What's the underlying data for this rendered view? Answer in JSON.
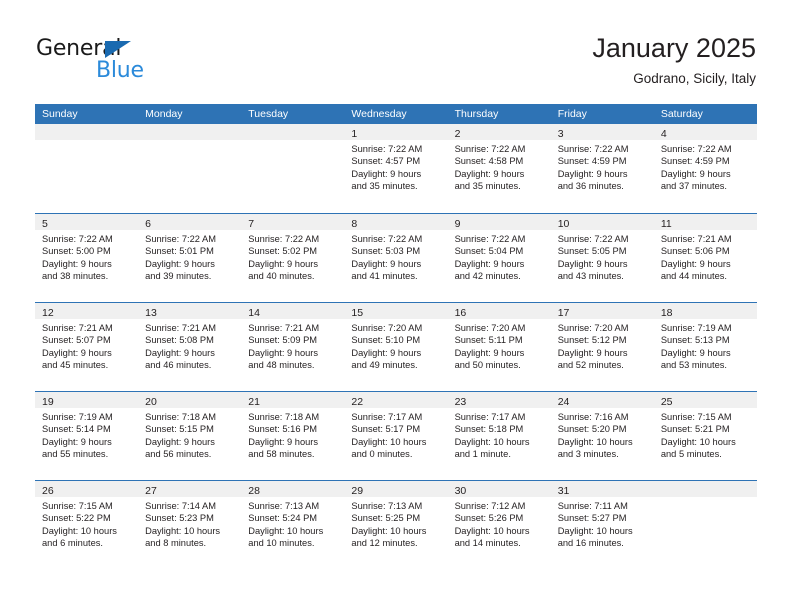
{
  "logo": {
    "word_one": "General",
    "word_two": "Blue",
    "triangle_color": "#1a6ab0",
    "blue_text_color": "#2b8ada"
  },
  "header": {
    "month_title": "January 2025",
    "location": "Godrano, Sicily, Italy"
  },
  "theme": {
    "header_blue": "#2e73b5",
    "daynum_band_gray": "#f0f0f0",
    "text_color": "#231f20"
  },
  "calendar": {
    "day_names": [
      "Sunday",
      "Monday",
      "Tuesday",
      "Wednesday",
      "Thursday",
      "Friday",
      "Saturday"
    ],
    "weeks": [
      [
        {
          "day": "",
          "sunrise": "",
          "sunset": "",
          "daylight_line1": "",
          "daylight_line2": "",
          "empty": true
        },
        {
          "day": "",
          "sunrise": "",
          "sunset": "",
          "daylight_line1": "",
          "daylight_line2": "",
          "empty": true
        },
        {
          "day": "",
          "sunrise": "",
          "sunset": "",
          "daylight_line1": "",
          "daylight_line2": "",
          "empty": true
        },
        {
          "day": "1",
          "sunrise": "Sunrise: 7:22 AM",
          "sunset": "Sunset: 4:57 PM",
          "daylight_line1": "Daylight: 9 hours",
          "daylight_line2": "and 35 minutes.",
          "empty": false
        },
        {
          "day": "2",
          "sunrise": "Sunrise: 7:22 AM",
          "sunset": "Sunset: 4:58 PM",
          "daylight_line1": "Daylight: 9 hours",
          "daylight_line2": "and 35 minutes.",
          "empty": false
        },
        {
          "day": "3",
          "sunrise": "Sunrise: 7:22 AM",
          "sunset": "Sunset: 4:59 PM",
          "daylight_line1": "Daylight: 9 hours",
          "daylight_line2": "and 36 minutes.",
          "empty": false
        },
        {
          "day": "4",
          "sunrise": "Sunrise: 7:22 AM",
          "sunset": "Sunset: 4:59 PM",
          "daylight_line1": "Daylight: 9 hours",
          "daylight_line2": "and 37 minutes.",
          "empty": false
        }
      ],
      [
        {
          "day": "5",
          "sunrise": "Sunrise: 7:22 AM",
          "sunset": "Sunset: 5:00 PM",
          "daylight_line1": "Daylight: 9 hours",
          "daylight_line2": "and 38 minutes.",
          "empty": false
        },
        {
          "day": "6",
          "sunrise": "Sunrise: 7:22 AM",
          "sunset": "Sunset: 5:01 PM",
          "daylight_line1": "Daylight: 9 hours",
          "daylight_line2": "and 39 minutes.",
          "empty": false
        },
        {
          "day": "7",
          "sunrise": "Sunrise: 7:22 AM",
          "sunset": "Sunset: 5:02 PM",
          "daylight_line1": "Daylight: 9 hours",
          "daylight_line2": "and 40 minutes.",
          "empty": false
        },
        {
          "day": "8",
          "sunrise": "Sunrise: 7:22 AM",
          "sunset": "Sunset: 5:03 PM",
          "daylight_line1": "Daylight: 9 hours",
          "daylight_line2": "and 41 minutes.",
          "empty": false
        },
        {
          "day": "9",
          "sunrise": "Sunrise: 7:22 AM",
          "sunset": "Sunset: 5:04 PM",
          "daylight_line1": "Daylight: 9 hours",
          "daylight_line2": "and 42 minutes.",
          "empty": false
        },
        {
          "day": "10",
          "sunrise": "Sunrise: 7:22 AM",
          "sunset": "Sunset: 5:05 PM",
          "daylight_line1": "Daylight: 9 hours",
          "daylight_line2": "and 43 minutes.",
          "empty": false
        },
        {
          "day": "11",
          "sunrise": "Sunrise: 7:21 AM",
          "sunset": "Sunset: 5:06 PM",
          "daylight_line1": "Daylight: 9 hours",
          "daylight_line2": "and 44 minutes.",
          "empty": false
        }
      ],
      [
        {
          "day": "12",
          "sunrise": "Sunrise: 7:21 AM",
          "sunset": "Sunset: 5:07 PM",
          "daylight_line1": "Daylight: 9 hours",
          "daylight_line2": "and 45 minutes.",
          "empty": false
        },
        {
          "day": "13",
          "sunrise": "Sunrise: 7:21 AM",
          "sunset": "Sunset: 5:08 PM",
          "daylight_line1": "Daylight: 9 hours",
          "daylight_line2": "and 46 minutes.",
          "empty": false
        },
        {
          "day": "14",
          "sunrise": "Sunrise: 7:21 AM",
          "sunset": "Sunset: 5:09 PM",
          "daylight_line1": "Daylight: 9 hours",
          "daylight_line2": "and 48 minutes.",
          "empty": false
        },
        {
          "day": "15",
          "sunrise": "Sunrise: 7:20 AM",
          "sunset": "Sunset: 5:10 PM",
          "daylight_line1": "Daylight: 9 hours",
          "daylight_line2": "and 49 minutes.",
          "empty": false
        },
        {
          "day": "16",
          "sunrise": "Sunrise: 7:20 AM",
          "sunset": "Sunset: 5:11 PM",
          "daylight_line1": "Daylight: 9 hours",
          "daylight_line2": "and 50 minutes.",
          "empty": false
        },
        {
          "day": "17",
          "sunrise": "Sunrise: 7:20 AM",
          "sunset": "Sunset: 5:12 PM",
          "daylight_line1": "Daylight: 9 hours",
          "daylight_line2": "and 52 minutes.",
          "empty": false
        },
        {
          "day": "18",
          "sunrise": "Sunrise: 7:19 AM",
          "sunset": "Sunset: 5:13 PM",
          "daylight_line1": "Daylight: 9 hours",
          "daylight_line2": "and 53 minutes.",
          "empty": false
        }
      ],
      [
        {
          "day": "19",
          "sunrise": "Sunrise: 7:19 AM",
          "sunset": "Sunset: 5:14 PM",
          "daylight_line1": "Daylight: 9 hours",
          "daylight_line2": "and 55 minutes.",
          "empty": false
        },
        {
          "day": "20",
          "sunrise": "Sunrise: 7:18 AM",
          "sunset": "Sunset: 5:15 PM",
          "daylight_line1": "Daylight: 9 hours",
          "daylight_line2": "and 56 minutes.",
          "empty": false
        },
        {
          "day": "21",
          "sunrise": "Sunrise: 7:18 AM",
          "sunset": "Sunset: 5:16 PM",
          "daylight_line1": "Daylight: 9 hours",
          "daylight_line2": "and 58 minutes.",
          "empty": false
        },
        {
          "day": "22",
          "sunrise": "Sunrise: 7:17 AM",
          "sunset": "Sunset: 5:17 PM",
          "daylight_line1": "Daylight: 10 hours",
          "daylight_line2": "and 0 minutes.",
          "empty": false
        },
        {
          "day": "23",
          "sunrise": "Sunrise: 7:17 AM",
          "sunset": "Sunset: 5:18 PM",
          "daylight_line1": "Daylight: 10 hours",
          "daylight_line2": "and 1 minute.",
          "empty": false
        },
        {
          "day": "24",
          "sunrise": "Sunrise: 7:16 AM",
          "sunset": "Sunset: 5:20 PM",
          "daylight_line1": "Daylight: 10 hours",
          "daylight_line2": "and 3 minutes.",
          "empty": false
        },
        {
          "day": "25",
          "sunrise": "Sunrise: 7:15 AM",
          "sunset": "Sunset: 5:21 PM",
          "daylight_line1": "Daylight: 10 hours",
          "daylight_line2": "and 5 minutes.",
          "empty": false
        }
      ],
      [
        {
          "day": "26",
          "sunrise": "Sunrise: 7:15 AM",
          "sunset": "Sunset: 5:22 PM",
          "daylight_line1": "Daylight: 10 hours",
          "daylight_line2": "and 6 minutes.",
          "empty": false
        },
        {
          "day": "27",
          "sunrise": "Sunrise: 7:14 AM",
          "sunset": "Sunset: 5:23 PM",
          "daylight_line1": "Daylight: 10 hours",
          "daylight_line2": "and 8 minutes.",
          "empty": false
        },
        {
          "day": "28",
          "sunrise": "Sunrise: 7:13 AM",
          "sunset": "Sunset: 5:24 PM",
          "daylight_line1": "Daylight: 10 hours",
          "daylight_line2": "and 10 minutes.",
          "empty": false
        },
        {
          "day": "29",
          "sunrise": "Sunrise: 7:13 AM",
          "sunset": "Sunset: 5:25 PM",
          "daylight_line1": "Daylight: 10 hours",
          "daylight_line2": "and 12 minutes.",
          "empty": false
        },
        {
          "day": "30",
          "sunrise": "Sunrise: 7:12 AM",
          "sunset": "Sunset: 5:26 PM",
          "daylight_line1": "Daylight: 10 hours",
          "daylight_line2": "and 14 minutes.",
          "empty": false
        },
        {
          "day": "31",
          "sunrise": "Sunrise: 7:11 AM",
          "sunset": "Sunset: 5:27 PM",
          "daylight_line1": "Daylight: 10 hours",
          "daylight_line2": "and 16 minutes.",
          "empty": false
        },
        {
          "day": "",
          "sunrise": "",
          "sunset": "",
          "daylight_line1": "",
          "daylight_line2": "",
          "empty": true
        }
      ]
    ]
  }
}
